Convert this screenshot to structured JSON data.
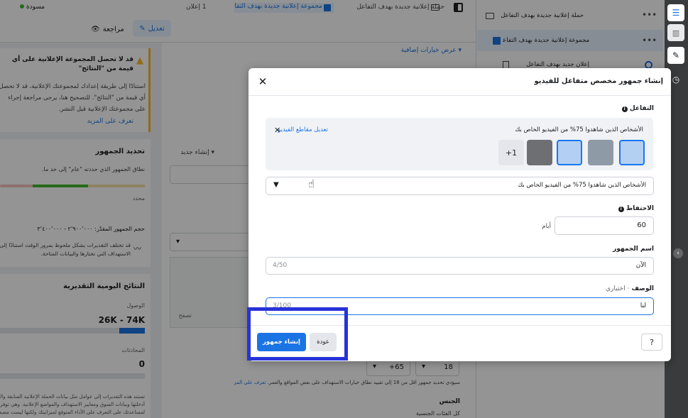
{
  "topbar": {
    "status_label": "مسودة",
    "review_label": "مراجعة",
    "edit_label": "تعديل",
    "breadcrumb_campaign": "حملة إعلانية جديدة بهدف التفاعل",
    "breadcrumb_adset": "مجموعة إعلانية جديدة بهدف التفاعل",
    "breadcrumb_ads": "1 إعلان"
  },
  "left_panel": {
    "warning_title": "قد لا تحصل المجموعة الإعلانية على أي قيمة من \"النتائج\"",
    "warning_body_1": "استنادًا إلى طريقة إعدادك لمجموعتك الإعلانية، قد لا تحصل",
    "warning_body_2": "أي قيمة من \"النتائج\". للتصحيح هنا، يرجى مراجعة إجراء",
    "warning_body_3": "على مجموعتك الإعلانية قبل النشر.",
    "warning_link": "تعرف على المزيد",
    "audience_title": "تحديد الجمهور",
    "audience_desc": "نطاق الجمهور الذي حددته \"عام\" إلى حد ما.",
    "audience_specific": "محدد",
    "audience_size": "حجم الجمهور المقدّر: ٢٬٩٠٠٬٠٠٠ - ٣٬٤٠٠٬٠٠٠",
    "audience_note_1": "قد تختلف التقديرات بشكل ملحوظ بمرور الوقت استنادًا إلى تحديد",
    "audience_note_2": "الاستهداف التي تختارها والبيانات المتاحة.",
    "daily_title": "النتائج اليومية التقديرية",
    "reach_label": "الوصول",
    "reach_value": "26K - 74K",
    "conversations_label": "المحادثات",
    "conversations_value": "0",
    "footnote_1": "تستند هذه التقديرات إلى عوامل مثل بيانات الحملة الإعلانية السابقة والميزانية",
    "footnote_2": "أدخلتها وبيانات السوق ومعايير الاستهداف والمواضع الإعلانية. وهي توفر",
    "footnote_3": "لمساعدتك على التعرف على الأداء المتوقع لميزانيتك ولكنها ليست مضمونة."
  },
  "center": {
    "more_options": "عرض خيارات إضافية",
    "create_new": "إنشاء جديد",
    "save_label": "تصفح",
    "age_min": "18",
    "age_max": "+65",
    "age_note": "سيؤدي تحديد جمهور أقل من 18 إلى تقييد نطاق خيارات الاستهداف على بعض المواقع والعمر.",
    "age_note_link": "تعرف على المزيد",
    "gender_label": "الجنس",
    "gender_value": "كل الفئات الجنسية"
  },
  "right_panel": {
    "campaign": "حملة إعلانية جديدة بهدف التفاعل",
    "adset": "مجموعة إعلانية جديدة بهدف التفاعل",
    "ad": "إعلان جديد بهدف التفاعل"
  },
  "modal": {
    "title": "إنشاء جمهور مخصص متفاعل للفيديو",
    "engagement_label": "التفاعل",
    "engagement_item": "الأشخاص الذين شاهدوا 75% من الفيديو الخاص بك",
    "edit_videos": "تعديل مقاطع الفيديو",
    "more_count": "+1",
    "engagement_select": "الأشخاص الذين شاهدوا 75% من الفيديو الخاص بك",
    "retention_label": "الاحتفاظ",
    "retention_value": "60",
    "retention_unit": "أيام",
    "name_label": "اسم الجمهور",
    "name_value": "الآن",
    "name_counter": "4/50",
    "desc_label": "الوصف",
    "desc_optional": "· اختياري",
    "desc_value": "لنا",
    "desc_counter": "3/100",
    "create_button": "إنشاء جمهور",
    "back_button": "عودة"
  }
}
